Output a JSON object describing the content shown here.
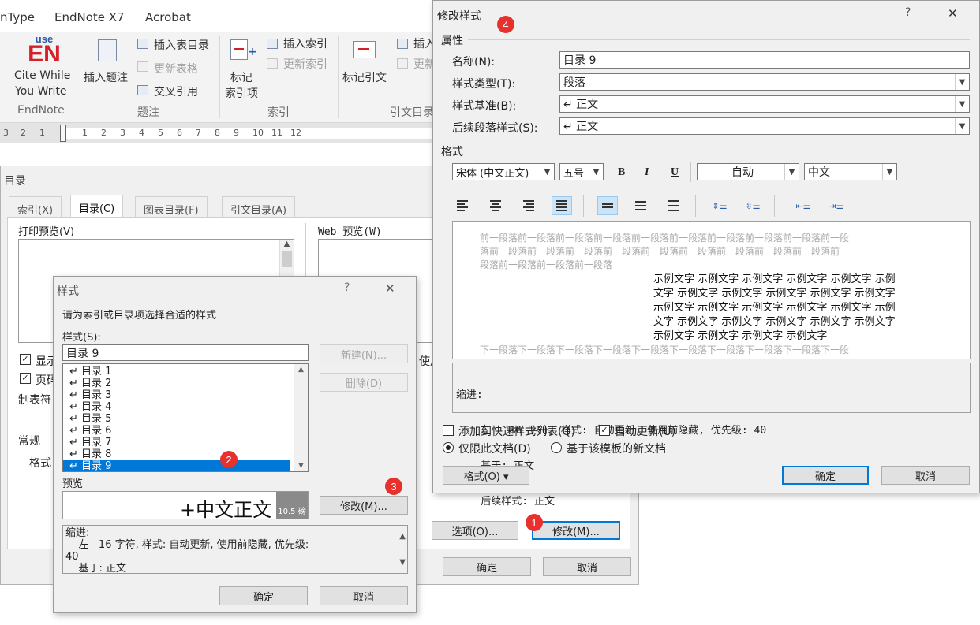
{
  "ribbon": {
    "tabs": [
      "nType",
      "EndNote X7",
      "Acrobat"
    ],
    "endnote_logo_top": "use",
    "endnote_logo_main": "EN",
    "cite_while_you_write": "Cite While",
    "cite_while_you_write_2": "You Write",
    "insert_caption": "插入题注",
    "insert_table_of_figures": "插入表目录",
    "update_table": "更新表格",
    "cross_reference": "交叉引用",
    "mark_entry_1": "标记",
    "mark_entry_2": "索引项",
    "insert_index": "插入索引",
    "update_index": "更新索引",
    "mark_citation": "标记引文",
    "insert_toa": "插入",
    "update_toa": "更新",
    "group_endnote": "EndNote",
    "group_captions": "题注",
    "group_index": "索引",
    "group_toa": "引文目录",
    "ruler_numbers": [
      "3",
      "2",
      "1",
      "1",
      "2",
      "3",
      "4",
      "5",
      "6",
      "7",
      "8",
      "9",
      "10",
      "11",
      "12"
    ]
  },
  "toc_dialog": {
    "title": "目录",
    "tabs": [
      "索引(X)",
      "目录(C)",
      "图表目录(F)",
      "引文目录(A)"
    ],
    "print_preview_label": "打印预览(V)",
    "web_preview_label": "Web 预览(W)",
    "show_page_numbers": "显示",
    "right_align": "页码",
    "tab_leader": "制表符",
    "use_hyperlinks": "使用",
    "general_label": "常规",
    "formats_label": "格式",
    "options_button": "选项(O)...",
    "modify_button": "修改(M)...",
    "ok_button": "确定",
    "cancel_button": "取消"
  },
  "styles_dialog": {
    "title": "样式",
    "help": "?",
    "close": "✕",
    "instruction": "请为索引或目录项选择合适的样式",
    "styles_label": "样式(S):",
    "style_input": "目录 9",
    "styles": [
      "目录 1",
      "目录 2",
      "目录 3",
      "目录 4",
      "目录 5",
      "目录 6",
      "目录 7",
      "目录 8",
      "目录 9"
    ],
    "selected_index": 8,
    "new_button": "新建(N)...",
    "delete_button": "删除(D)",
    "preview_label": "预览",
    "preview_text": "+中文正文",
    "preview_size": "10.5 磅",
    "modify_button": "修改(M)...",
    "description_lines": [
      "缩进:",
      "    左   16 字符, 样式: 自动更新, 使用前隐藏, 优先级:",
      "40",
      "    基于: 正文"
    ],
    "ok_button": "确定",
    "cancel_button": "取消"
  },
  "modify_dialog": {
    "title": "修改样式",
    "help": "?",
    "close": "✕",
    "properties_label": "属性",
    "name_label": "名称(N):",
    "name_value": "目录 9",
    "style_type_label": "样式类型(T):",
    "style_type_value": "段落",
    "based_on_label": "样式基准(B):",
    "based_on_value": "↵ 正文",
    "next_style_label": "后续段落样式(S):",
    "next_style_value": "↵ 正文",
    "format_label": "格式",
    "font_value": "宋体 (中文正文)",
    "size_value": "五号",
    "bold": "B",
    "italic": "I",
    "underline": "U",
    "color_value": "自动",
    "language_value": "中文",
    "preview_before": [
      "前一段落前一段落前一段落前一段落前一段落前一段落前一段落前一段落前一段落前一段",
      "落前一段落前一段落前一段落前一段落前一段落前一段落前一段落前一段落前一段落前一",
      "段落前一段落前一段落前一段落"
    ],
    "preview_sample": [
      "示例文字 示例文字 示例文字 示例文字 示例文字 示例",
      "文字 示例文字 示例文字 示例文字 示例文字 示例文字",
      "示例文字 示例文字 示例文字 示例文字 示例文字 示例",
      "文字 示例文字 示例文字 示例文字 示例文字 示例文字",
      "示例文字 示例文字 示例文字 示例文字"
    ],
    "preview_after": [
      "下一段落下一段落下一段落下一段落下一段落下一段落下一段落下一段落下一段落下一段"
    ],
    "description_lines": [
      "缩进:",
      "    左   16 字符, 样式: 自动更新, 使用前隐藏, 优先级: 40",
      "    基于: 正文",
      "    后续样式: 正文"
    ],
    "add_to_gallery_label": "添加到快速样式列表(Q)",
    "auto_update_label": "自动更新(U)",
    "only_this_doc_label": "仅限此文档(D)",
    "new_docs_label": "基于该模板的新文档",
    "format_button": "格式(O) ▾",
    "ok_button": "确定",
    "cancel_button": "取消"
  },
  "markers": [
    "1",
    "2",
    "3",
    "4"
  ],
  "colors": {
    "accent": "#0078d7",
    "marker": "#e8302c",
    "dialog_bg": "#f0f0f0"
  }
}
